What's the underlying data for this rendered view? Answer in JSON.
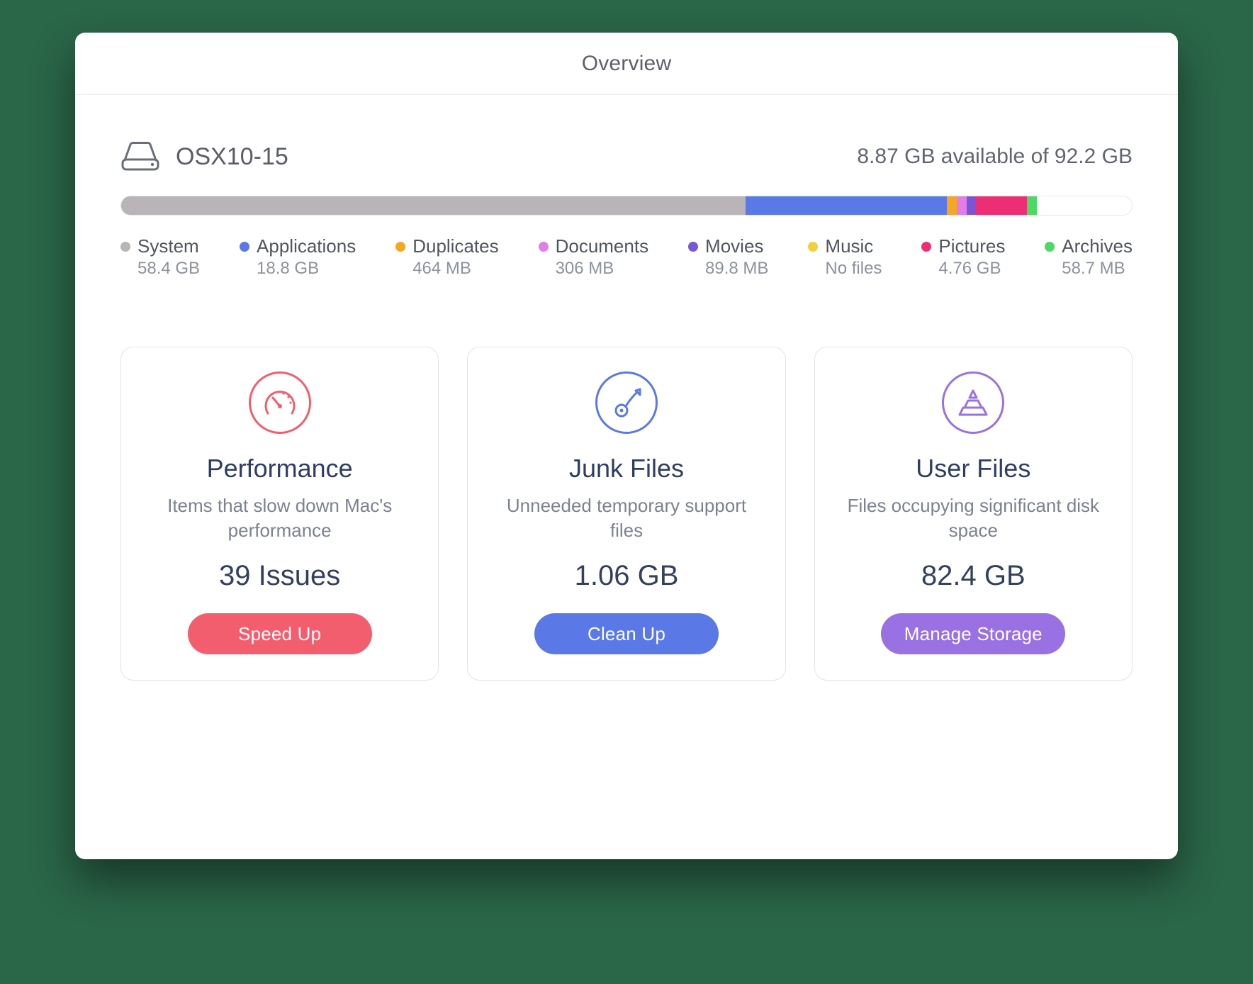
{
  "header": {
    "title": "Overview"
  },
  "disk": {
    "name": "OSX10-15",
    "available_text": "8.87 GB available of 92.2 GB",
    "available_gb": 8.87,
    "total_gb": 92.2
  },
  "chart_data": {
    "type": "bar",
    "title": "Disk usage by category",
    "categories": [
      "System",
      "Applications",
      "Duplicates",
      "Documents",
      "Movies",
      "Music",
      "Pictures",
      "Archives",
      "Free"
    ],
    "values_gb": [
      58.4,
      18.8,
      0.464,
      0.306,
      0.0898,
      0.0,
      4.76,
      0.0587,
      8.87
    ],
    "colors": [
      "#b8b4b8",
      "#5a79e7",
      "#f5a623",
      "#e07de8",
      "#7856d6",
      "#f3cf3f",
      "#ee2e74",
      "#4cd964",
      "#ffffff"
    ],
    "xlabel": "",
    "ylabel": "GB",
    "ylim": [
      0,
      92.2
    ]
  },
  "legend": [
    {
      "label": "System",
      "size": "58.4 GB",
      "color": "#b8b4b8"
    },
    {
      "label": "Applications",
      "size": "18.8 GB",
      "color": "#5a79e7"
    },
    {
      "label": "Duplicates",
      "size": "464 MB",
      "color": "#f5a623"
    },
    {
      "label": "Documents",
      "size": "306 MB",
      "color": "#e07de8"
    },
    {
      "label": "Movies",
      "size": "89.8 MB",
      "color": "#7856d6"
    },
    {
      "label": "Music",
      "size": "No files",
      "color": "#f3cf3f"
    },
    {
      "label": "Pictures",
      "size": "4.76 GB",
      "color": "#ee2e74"
    },
    {
      "label": "Archives",
      "size": "58.7 MB",
      "color": "#4cd964"
    }
  ],
  "cards": {
    "performance": {
      "title": "Performance",
      "desc": "Items that slow down Mac's performance",
      "metric": "39 Issues",
      "button": "Speed Up",
      "accent": "#f25e6e"
    },
    "junk": {
      "title": "Junk Files",
      "desc": "Unneeded temporary support files",
      "metric": "1.06 GB",
      "button": "Clean Up",
      "accent": "#5a79e7"
    },
    "user": {
      "title": "User Files",
      "desc": "Files occupying significant disk space",
      "metric": "82.4 GB",
      "button": "Manage Storage",
      "accent": "#9a71e3"
    }
  }
}
